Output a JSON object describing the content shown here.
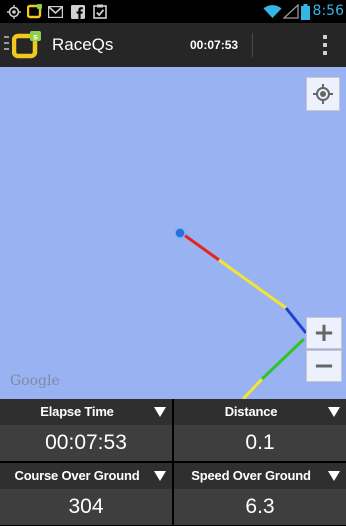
{
  "status_bar": {
    "time": "8:56",
    "left_icons": [
      "location-target-icon",
      "raceqs-notification-icon",
      "gmail-icon",
      "facebook-icon",
      "clipboard-check-icon"
    ],
    "right_icons": [
      "wifi-icon",
      "signal-icon",
      "battery-icon"
    ],
    "accent_color": "#33b5e5"
  },
  "action_bar": {
    "title": "RaceQs",
    "timer": "00:07:53",
    "overflow_icon": "overflow-menu-icon"
  },
  "map": {
    "attribution": "Google",
    "controls": {
      "locate_icon": "my-location-icon",
      "zoom_in": "+",
      "zoom_out": "−"
    },
    "track_colors": [
      "#e8231c",
      "#f2e62e",
      "#1e3fd6",
      "#2fc42a",
      "#f2e62e"
    ]
  },
  "data_panel": {
    "cells": [
      {
        "label": "Elapse Time",
        "value": "00:07:53"
      },
      {
        "label": "Distance",
        "value": "0.1"
      },
      {
        "label": "Course Over Ground",
        "value": "304"
      },
      {
        "label": "Speed Over Ground",
        "value": "6.3"
      }
    ]
  }
}
